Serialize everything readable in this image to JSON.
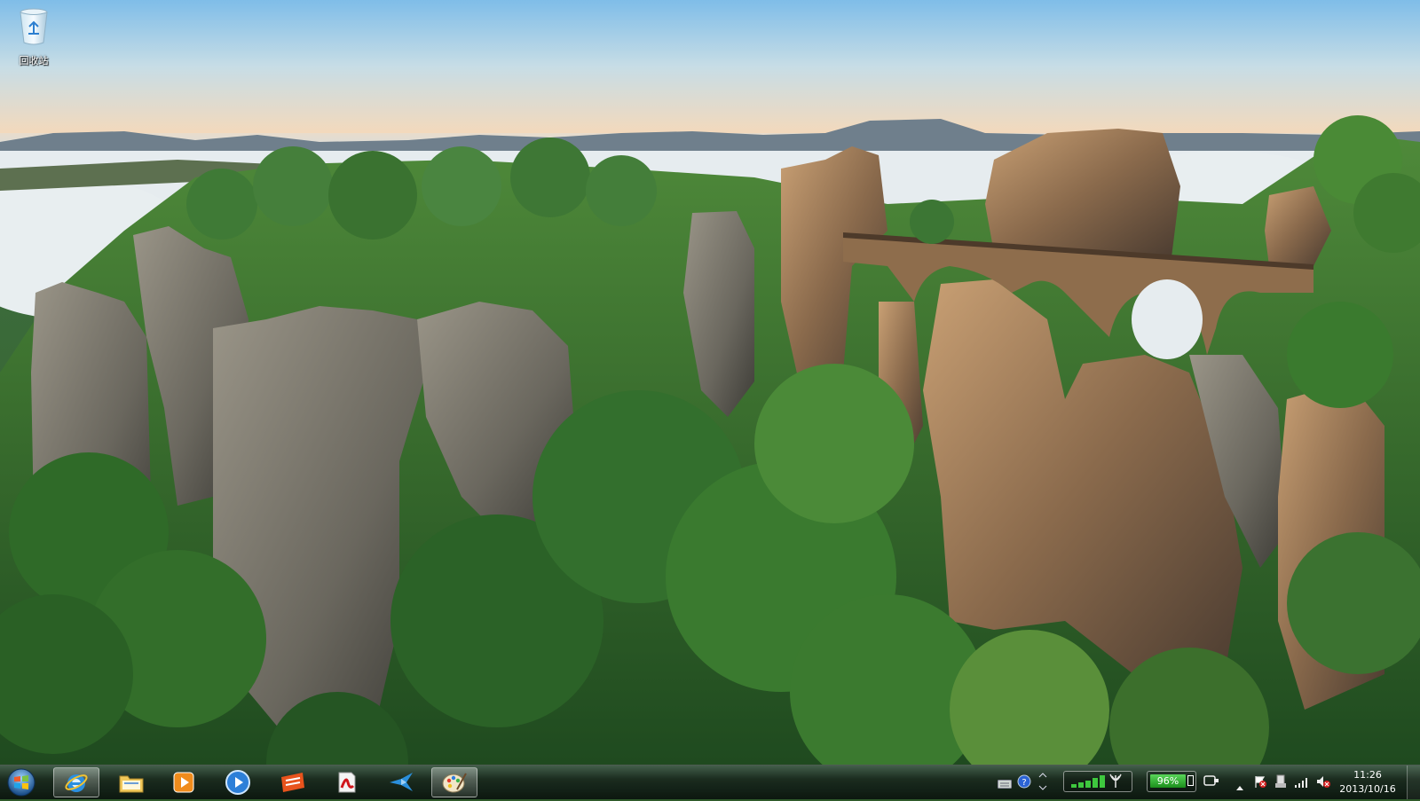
{
  "desktop": {
    "icons": [
      {
        "label": "回收站",
        "icon": "recycle-bin-icon"
      }
    ]
  },
  "taskbar": {
    "start_icon": "windows-start-orb-icon",
    "pinned": [
      {
        "name": "internet-explorer",
        "icon": "ie-icon",
        "active": true
      },
      {
        "name": "file-explorer",
        "icon": "folder-icon",
        "active": false
      },
      {
        "name": "media-player",
        "icon": "media-player-icon",
        "active": false
      },
      {
        "name": "media-center",
        "icon": "play-circle-icon",
        "active": false
      },
      {
        "name": "app-orange",
        "icon": "orange-app-icon",
        "active": false
      },
      {
        "name": "acrobat",
        "icon": "pdf-icon",
        "active": false
      },
      {
        "name": "bird-app",
        "icon": "bird-icon",
        "active": false
      },
      {
        "name": "paint",
        "icon": "paint-palette-icon",
        "active": true
      }
    ]
  },
  "tray": {
    "battery_percent": "96%",
    "time": "11:26",
    "date": "2013/10/16"
  },
  "colors": {
    "battery_green": "#3cb83c",
    "signal_green": "#3ec83e"
  }
}
